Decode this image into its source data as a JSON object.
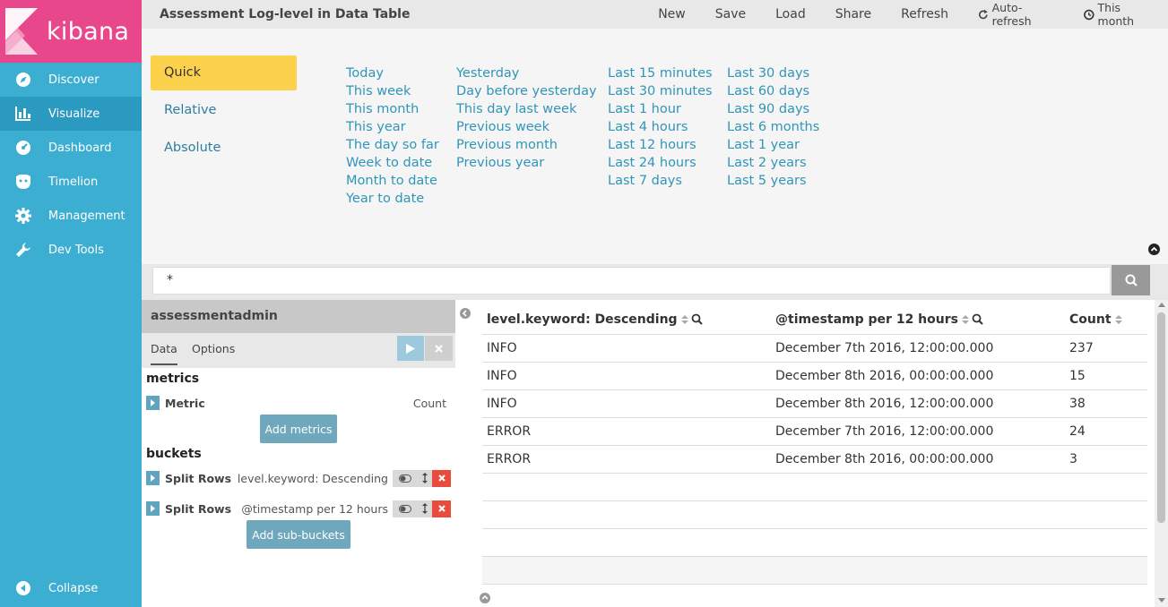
{
  "brand": {
    "name": "kibana",
    "color": "#e8488b"
  },
  "sidebar": {
    "items": [
      {
        "label": "Discover",
        "icon": "compass-icon"
      },
      {
        "label": "Visualize",
        "icon": "bar-chart-icon",
        "active": true
      },
      {
        "label": "Dashboard",
        "icon": "dashboard-icon"
      },
      {
        "label": "Timelion",
        "icon": "timelion-icon"
      },
      {
        "label": "Management",
        "icon": "gear-icon"
      },
      {
        "label": "Dev Tools",
        "icon": "wrench-icon"
      }
    ],
    "collapse_label": "Collapse"
  },
  "topbar": {
    "title": "Assessment Log-level in Data Table",
    "new_label": "New",
    "save_label": "Save",
    "load_label": "Load",
    "share_label": "Share",
    "refresh_label": "Refresh",
    "auto_refresh_label": "Auto-refresh",
    "time_label": "This month"
  },
  "timepicker": {
    "modes": [
      "Quick",
      "Relative",
      "Absolute"
    ],
    "active_mode": "Quick",
    "columns": [
      [
        "Today",
        "This week",
        "This month",
        "This year",
        "The day so far",
        "Week to date",
        "Month to date",
        "Year to date"
      ],
      [
        "Yesterday",
        "Day before yesterday",
        "This day last week",
        "Previous week",
        "Previous month",
        "Previous year"
      ],
      [
        "Last 15 minutes",
        "Last 30 minutes",
        "Last 1 hour",
        "Last 4 hours",
        "Last 12 hours",
        "Last 24 hours",
        "Last 7 days"
      ],
      [
        "Last 30 days",
        "Last 60 days",
        "Last 90 days",
        "Last 6 months",
        "Last 1 year",
        "Last 2 years",
        "Last 5 years"
      ]
    ]
  },
  "search": {
    "value": "*"
  },
  "editor": {
    "index_name": "assessmentadmin",
    "tabs": [
      "Data",
      "Options"
    ],
    "metrics_title": "metrics",
    "metric": {
      "label": "Metric",
      "value": "Count"
    },
    "add_metrics_label": "Add metrics",
    "buckets_title": "buckets",
    "buckets": [
      {
        "label": "Split Rows",
        "value": "level.keyword: Descending"
      },
      {
        "label": "Split Rows",
        "value": "@timestamp per 12 hours"
      }
    ],
    "add_sub_buckets_label": "Add sub-buckets"
  },
  "table": {
    "headers": [
      "level.keyword: Descending",
      "@timestamp per 12 hours",
      "Count"
    ],
    "rows": [
      [
        "INFO",
        "December 7th 2016, 12:00:00.000",
        "237"
      ],
      [
        "INFO",
        "December 8th 2016, 00:00:00.000",
        "15"
      ],
      [
        "INFO",
        "December 8th 2016, 12:00:00.000",
        "38"
      ],
      [
        "ERROR",
        "December 7th 2016, 12:00:00.000",
        "24"
      ],
      [
        "ERROR",
        "December 8th 2016, 00:00:00.000",
        "3"
      ]
    ]
  }
}
